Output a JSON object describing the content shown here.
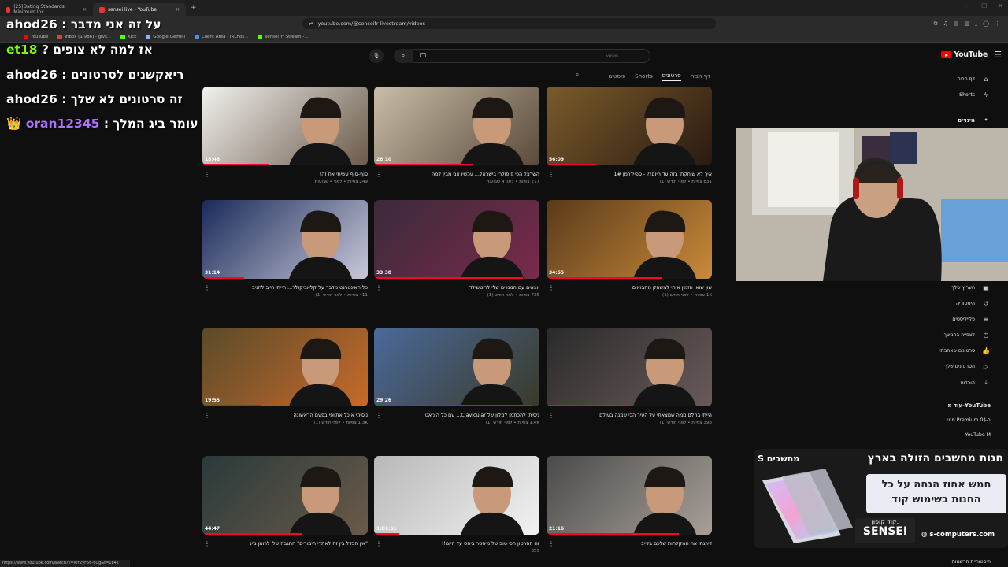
{
  "browser": {
    "tabs": [
      {
        "label": "(25)Dating Standards: Minimum Inc...",
        "active": false
      },
      {
        "label": "sensei live - YouTube",
        "active": true
      }
    ],
    "url": "youtube.com/@senseifr-livestream/videos",
    "bookmarks": [
      {
        "label": "YouTube",
        "color": "#ff0000"
      },
      {
        "label": "Inbox (1,986) - givs...",
        "color": "#d44638"
      },
      {
        "label": "Kick",
        "color": "#53fc18"
      },
      {
        "label": "Google Gemini",
        "color": "#8ab4f8"
      },
      {
        "label": "Client Area - IRLhos...",
        "color": "#4a90e2"
      },
      {
        "label": "sensei_fr Stream -...",
        "color": "#53fc18"
      }
    ],
    "status_url": "https://www.youtube.com/watch?v=MY2yF56-6Ug&t=184s"
  },
  "youtube": {
    "logo": "YouTube",
    "search_placeholder": "חיפוש",
    "channel_tabs": [
      "דף הבית",
      "סרטונים",
      "Shorts",
      "פוסטים"
    ],
    "active_tab": "סרטונים",
    "sidebar": {
      "top": [
        {
          "label": "דף הבית",
          "icon": "home-icon"
        },
        {
          "label": "Shorts",
          "icon": "shorts-icon"
        }
      ],
      "subs_header": "מינויים",
      "you_items": [
        {
          "label": "הערוץ שלך",
          "icon": "account-icon"
        },
        {
          "label": "היסטוריה",
          "icon": "history-icon"
        },
        {
          "label": "פלייליסטים",
          "icon": "playlist-icon"
        },
        {
          "label": "לצפייה בהמשך",
          "icon": "clock-icon"
        },
        {
          "label": "סרטונים שאהבתי",
          "icon": "like-icon"
        },
        {
          "label": "הסרטונים שלך",
          "icon": "video-icon"
        },
        {
          "label": "הורדות",
          "icon": "download-icon"
        }
      ],
      "more_header": "עוד מ-YouTube",
      "more_items": [
        "מנוי Premium ב-0$",
        "YouTube M"
      ],
      "bottom_item": "היסטוריית הרשמות"
    },
    "videos": [
      {
        "title": "איך לא שיחקתי בזה עד היום!? - ספיידרמן 1#",
        "meta": "831 צפיות • לפני חודש (1)",
        "duration": "56:09"
      },
      {
        "title": "השרצל הכי פופולרי בישראל... עכשיו אני מבין למה",
        "meta": "277 צפיות • לפני 4 שבועות",
        "duration": "26:10"
      },
      {
        "title": "סוף-סוף עשיתי את זה!",
        "meta": "249 צפיות • לפני 4 שבועות",
        "duration": "18:46"
      },
      {
        "title": "שון שואו הזמין אותי למשחק מחבואים",
        "meta": "1K צפיות • לפני חודש (1)",
        "duration": "34:55"
      },
      {
        "title": "יוצאים עם המנויים שלי לרוטשילד",
        "meta": "736 צפיות • לפני חודש (1)",
        "duration": "33:38"
      },
      {
        "title": "כל האינטרנט מדבר על קלאביקולר... הייתי חייב להגיב",
        "meta": "411 צפיות • לפני חודש (1)",
        "duration": "31:14"
      },
      {
        "title": "הייתי בהלם ממה שמצאתי על העיר הכי שמנה בעולם",
        "meta": "398 צפיות • לפני חודש (1)",
        "duration": ""
      },
      {
        "title": "ניסיתי להכתמן למלון של Clavicular... עם כל הצ'אט",
        "meta": "1.4K צפיות • לפני חודש (1)",
        "duration": "29:26"
      },
      {
        "title": "ניסיתי אוכל אתיופי בפעם הראשונה",
        "meta": "1.3K צפיות • לפני חודש (1)",
        "duration": "19:55"
      },
      {
        "title": "דירגתי את המקלחות שלכם בלייב",
        "meta": "",
        "duration": "21:16"
      },
      {
        "title": "זה הסרטון הכי טוב של מיסטר ביסט עד היום!!",
        "meta": "855",
        "duration": "1:01:51"
      },
      {
        "title": "\"אין הבדל בין זה לאתרי הימורים\" ההגבה שלי לרומן ג'ינ",
        "meta": "",
        "duration": "44:47"
      }
    ]
  },
  "stream_overlay": {
    "chat": [
      {
        "user": "ahod26",
        "text": "על זה אני מדבר :"
      },
      {
        "user": "et18",
        "text": "אז למה לא צופים ?",
        "user_color": "#7cfc00"
      },
      {
        "user": "ahod26",
        "text": "ריאקשנים לסרטונים :"
      },
      {
        "user": "ahod26",
        "text": "זה סרטונים לא שלך :"
      },
      {
        "user": "oran12345",
        "text": "עומר ביג המלך :",
        "user_color": "#b070ff",
        "badge": "crown"
      }
    ],
    "ad": {
      "headline": "חנות מחשבים הזולה בארץ",
      "brand_label": "מחשבים",
      "offer": "חמש אחוז הנחה על כל החנות בשימוש קוד",
      "coupon_label": "קוד קופון:",
      "coupon": "SENSEI",
      "site": "s-computers.com"
    }
  },
  "colors": {
    "accent": "#ff0000",
    "bg": "#0f0f0f"
  }
}
